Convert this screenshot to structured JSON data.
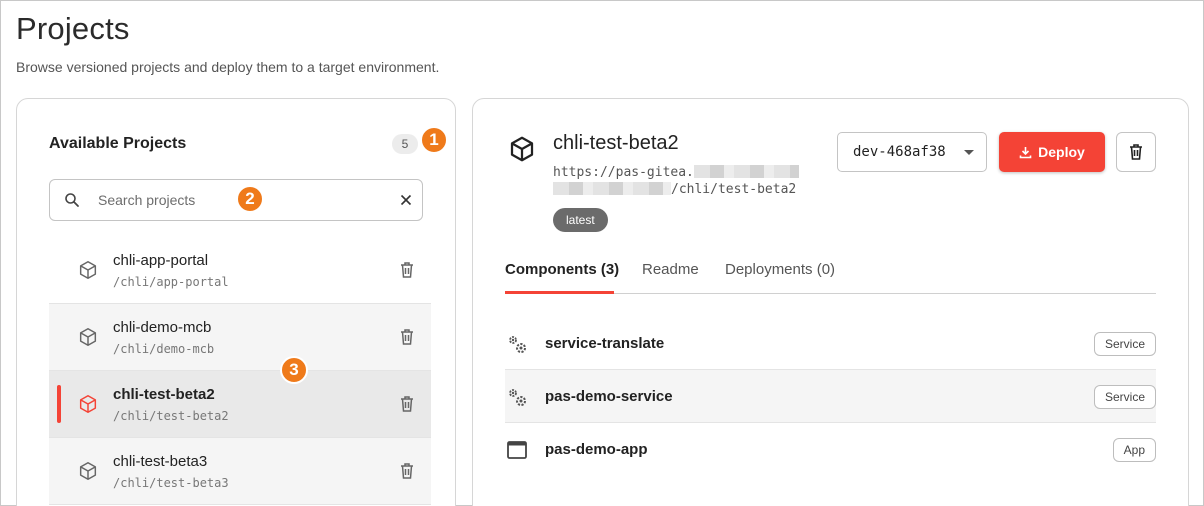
{
  "page": {
    "title": "Projects",
    "subtitle": "Browse versioned projects and deploy them to a target environment."
  },
  "sidebar": {
    "title": "Available Projects",
    "count": "5",
    "search": {
      "placeholder": "Search projects",
      "value": ""
    },
    "items": [
      {
        "name": "chli-app-portal",
        "path": "/chli/app-portal"
      },
      {
        "name": "chli-demo-mcb",
        "path": "/chli/demo-mcb"
      },
      {
        "name": "chli-test-beta2",
        "path": "/chli/test-beta2"
      },
      {
        "name": "chli-test-beta3",
        "path": "/chli/test-beta3"
      }
    ]
  },
  "callouts": {
    "one": "1",
    "two": "2",
    "three": "3"
  },
  "detail": {
    "name": "chli-test-beta2",
    "url_prefix": "https://pas-gitea.",
    "url_suffix": "/chli/test-beta2",
    "tag": "latest",
    "version": "dev-468af38",
    "deploy_label": "Deploy",
    "tabs": [
      "Components (3)",
      "Readme",
      "Deployments (0)"
    ],
    "components": [
      {
        "name": "service-translate",
        "type": "Service"
      },
      {
        "name": "pas-demo-service",
        "type": "Service"
      },
      {
        "name": "pas-demo-app",
        "type": "App"
      }
    ]
  },
  "colors": {
    "accent": "#f44336",
    "callout": "#ef7a1a"
  }
}
